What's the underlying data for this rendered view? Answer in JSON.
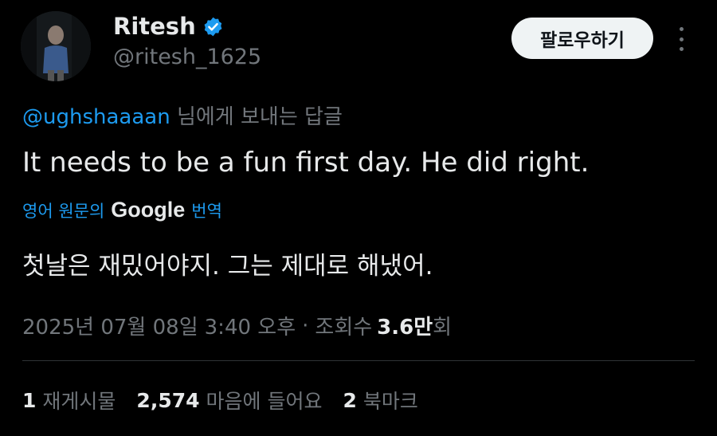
{
  "author": {
    "name": "Ritesh",
    "handle": "@ritesh_1625",
    "verified_icon": "verified-badge-icon"
  },
  "follow_label": "팔로우하기",
  "reply_to": {
    "mention": "@ughshaaaan",
    "suffix": "님에게 보내는 답글"
  },
  "tweet_text": "It needs to be a fun first day. He did right.",
  "translation": {
    "prefix": "영어 원문의",
    "provider": "Google",
    "suffix": "번역",
    "text": "첫날은 재밌어야지. 그는 제대로 해냈어."
  },
  "meta": {
    "date": "2025년 07월 08일",
    "time": "3:40 오후",
    "views_label": "조회수",
    "views_value": "3.6만",
    "views_suffix": "회",
    "separator": "·"
  },
  "stats": [
    {
      "value": "1",
      "label": "재게시물"
    },
    {
      "value": "2,574",
      "label": "마음에 들어요"
    },
    {
      "value": "2",
      "label": "북마크"
    }
  ],
  "colors": {
    "background": "#000000",
    "accent": "#1d9bf0",
    "muted": "#71767b",
    "text": "#e7e9ea"
  }
}
